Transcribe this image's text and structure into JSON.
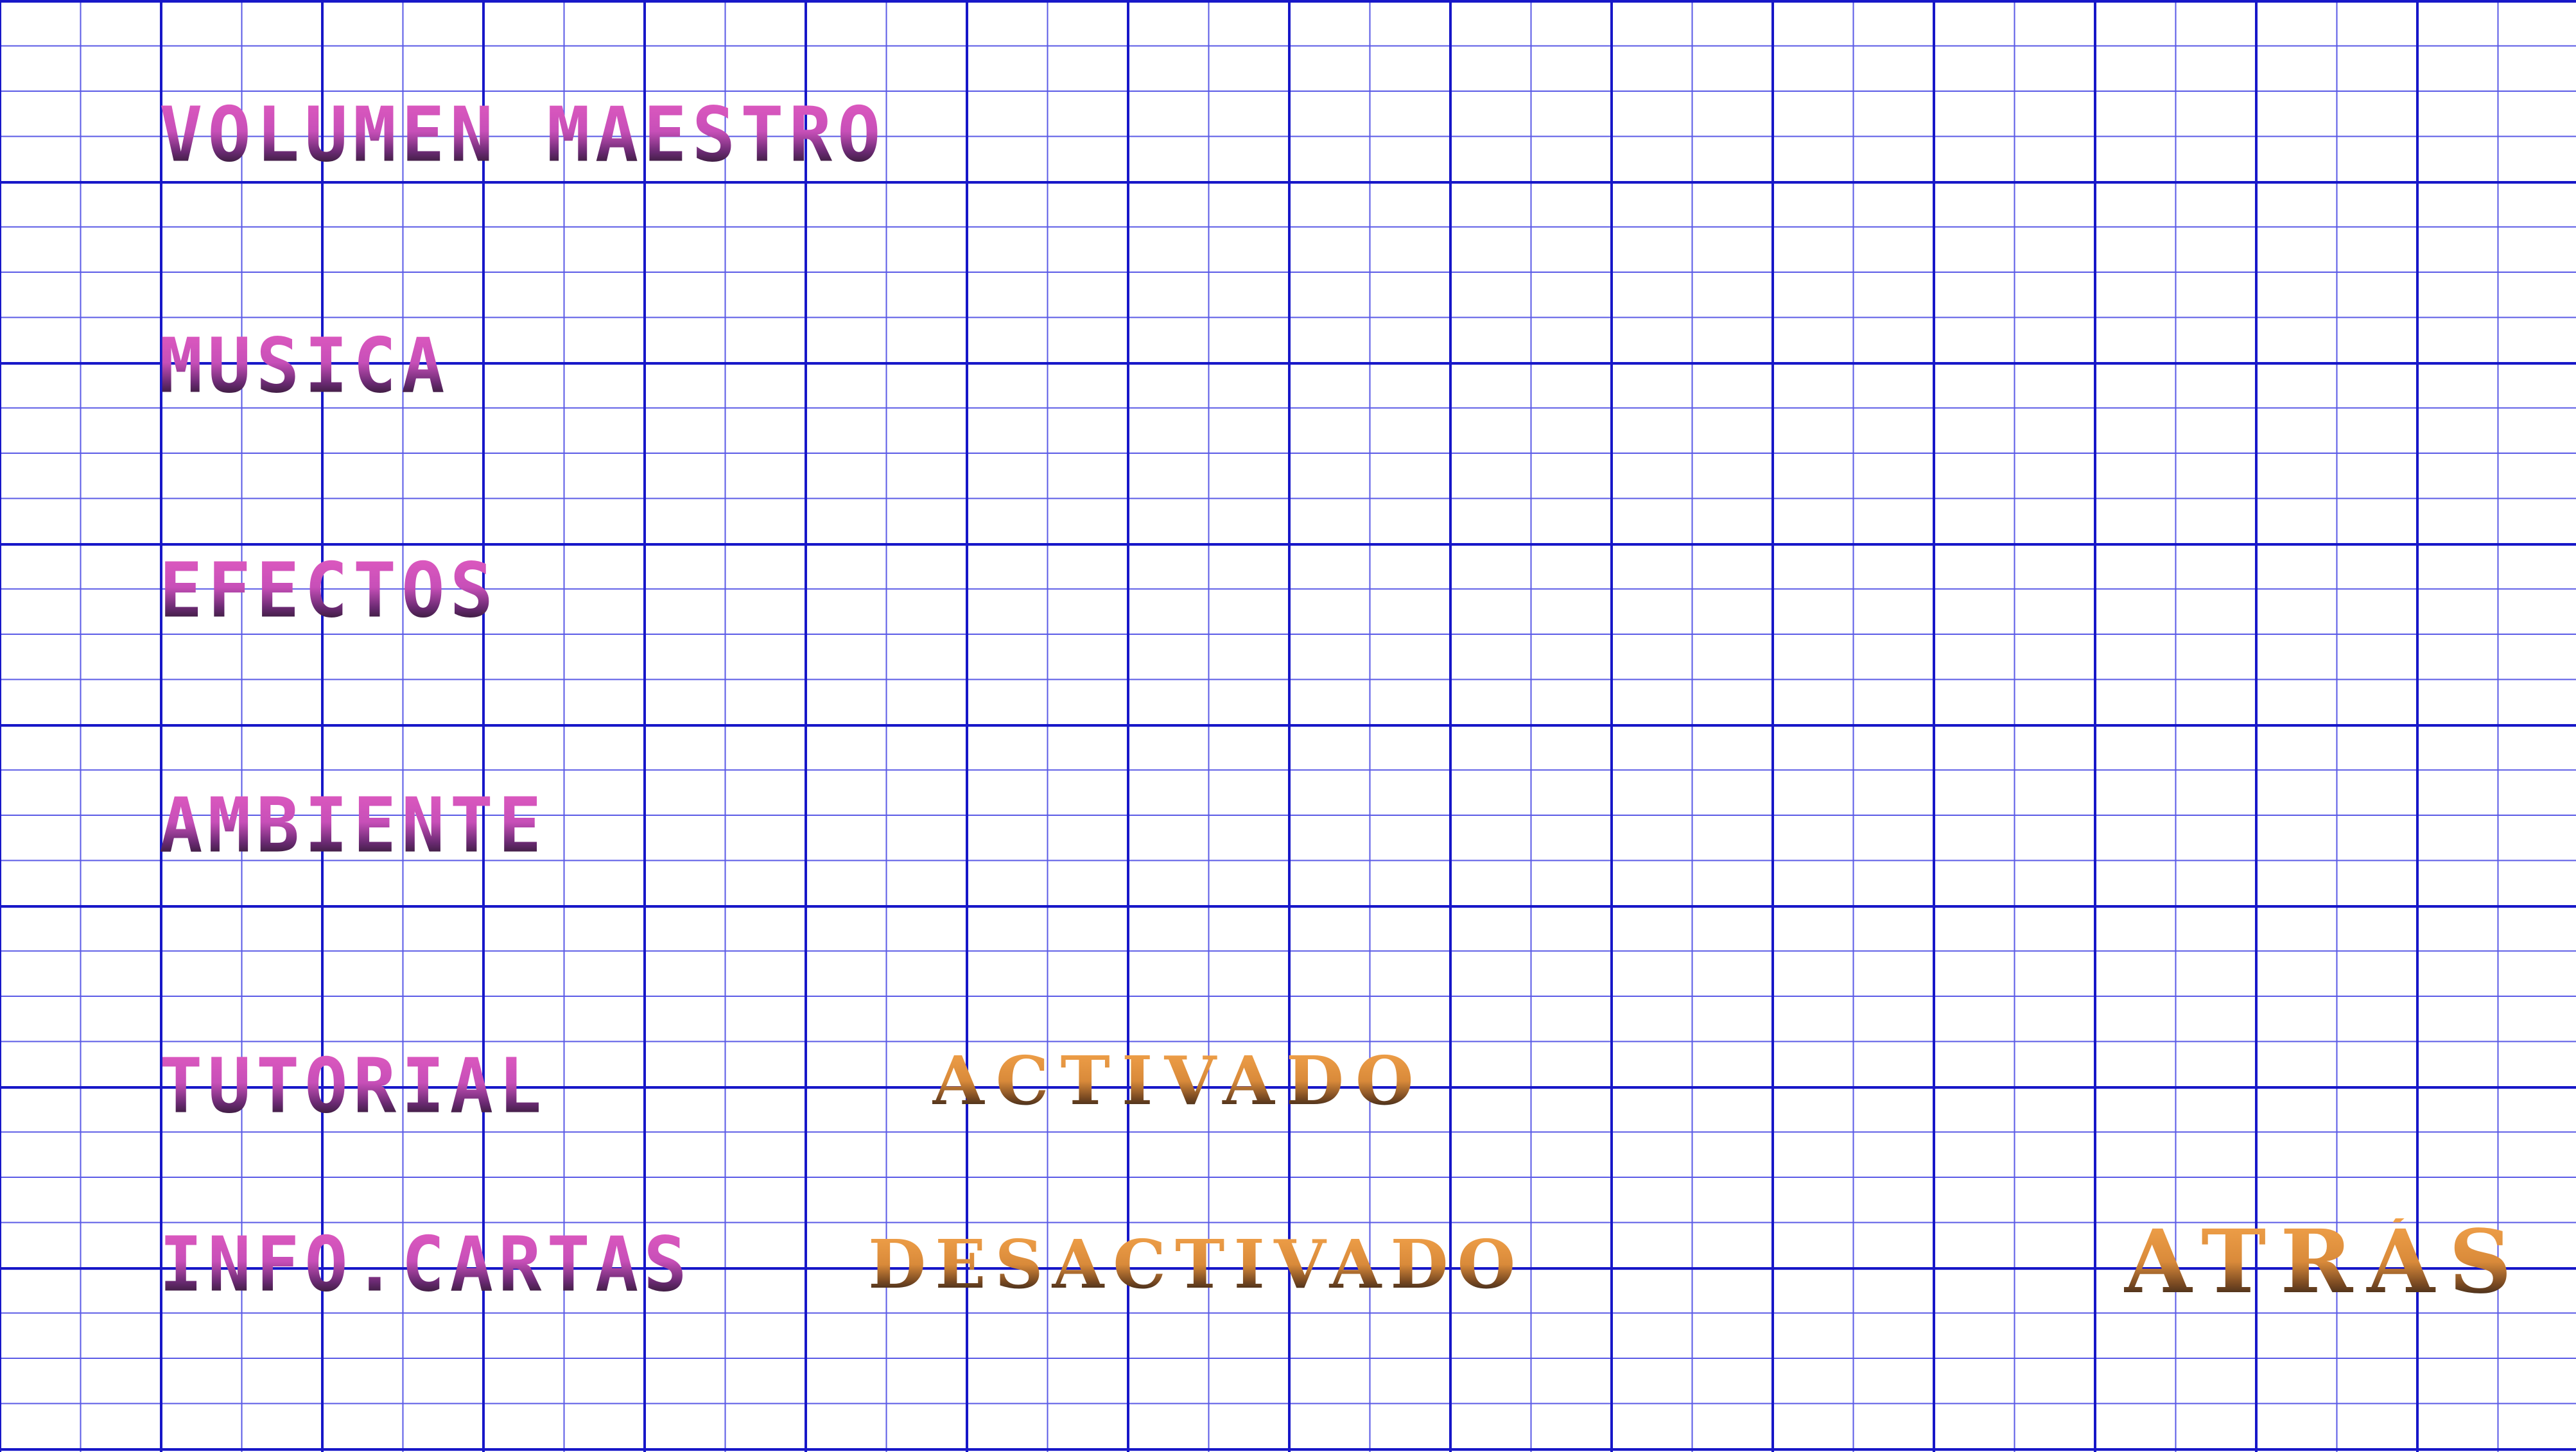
{
  "options": {
    "master_volume": "VOLUMEN MAESTRO",
    "music": "MUSICA",
    "effects": "EFECTOS",
    "ambient": "AMBIENTE",
    "tutorial": "TUTORIAL",
    "info_cards": "INFO.CARTAS"
  },
  "values": {
    "tutorial": "ACTIVADO",
    "info_cards": "DESACTIVADO"
  },
  "back_label": "ATRÁS",
  "colors": {
    "grid_major": "#1717c8",
    "grid_minor": "#5a5ae6",
    "label_pink": "#e05ac0",
    "value_orange": "#e0913e",
    "background": "#ffffff"
  }
}
